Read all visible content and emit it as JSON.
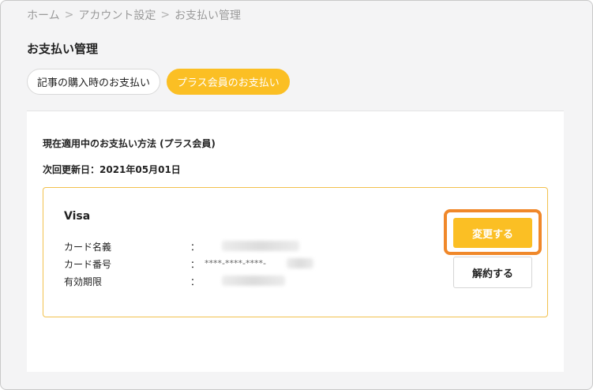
{
  "breadcrumb": {
    "items": [
      "ホーム",
      "アカウント設定",
      "お支払い管理"
    ],
    "separator": ">"
  },
  "page": {
    "title": "お支払い管理"
  },
  "tabs": [
    {
      "label": "記事の購入時のお支払い",
      "active": false
    },
    {
      "label": "プラス会員のお支払い",
      "active": true
    }
  ],
  "payment": {
    "current_method_label": "現在適用中のお支払い方法 (プラス会員)",
    "renewal_label": "次回更新日：2021年05月01日",
    "card": {
      "brand": "Visa",
      "holder_label": "カード名義",
      "number_label": "カード番号",
      "number_value": "****-****-****-",
      "expiry_label": "有効期限",
      "colon": "："
    },
    "change_button": "変更する",
    "cancel_button": "解約する"
  },
  "colors": {
    "accent": "#fbbf24",
    "highlight": "#f0882a",
    "card_border": "#f2c14e"
  }
}
